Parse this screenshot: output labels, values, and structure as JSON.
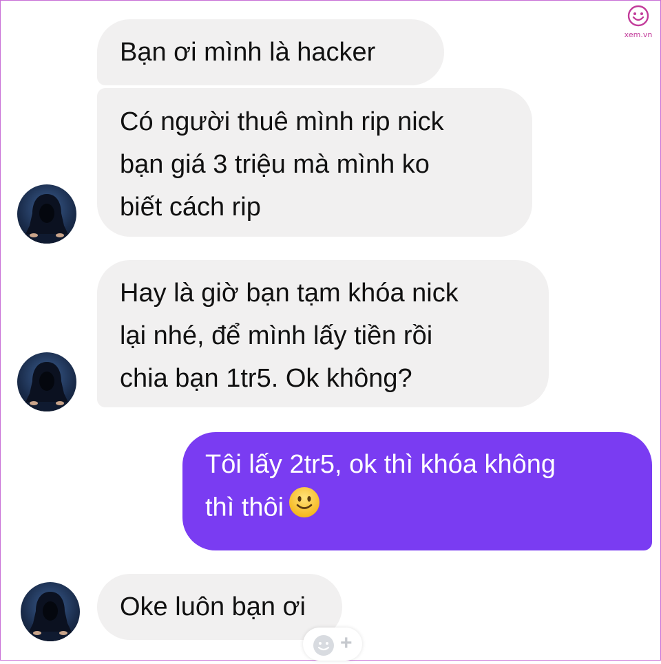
{
  "watermark": {
    "text": "xem.vn",
    "icon": "smiley-face-icon"
  },
  "messages": [
    {
      "id": "m1",
      "direction": "incoming",
      "lines": [
        "Bạn ơi mình là hacker"
      ]
    },
    {
      "id": "m2",
      "direction": "incoming",
      "lines": [
        "Có người thuê mình rip nick",
        "bạn giá 3 triệu  mà mình ko",
        "biết cách rip"
      ]
    },
    {
      "id": "m3",
      "direction": "incoming",
      "lines": [
        "Hay là giờ bạn tạm khóa nick",
        "lại nhé, để mình lấy tiền rồi",
        "chia bạn 1tr5. Ok không?"
      ]
    },
    {
      "id": "m4",
      "direction": "outgoing",
      "lines": [
        "Tôi lấy 2tr5, ok thì khóa không",
        "thì thôi"
      ],
      "emoji": "slightly-smiling-face-emoji"
    },
    {
      "id": "m5",
      "direction": "incoming",
      "lines": [
        "Oke luôn bạn ơi"
      ]
    }
  ],
  "reaction_button": {
    "icon": "add-reaction-icon",
    "symbol": "+"
  },
  "colors": {
    "incoming_bubble": "#f1f0f0",
    "outgoing_bubble": "#7a3cf2",
    "frame": "#c86fd6"
  }
}
